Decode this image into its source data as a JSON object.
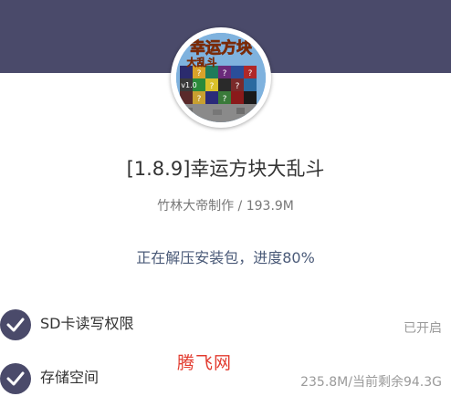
{
  "header": {
    "color": "#4a4a6a"
  },
  "app": {
    "icon": "minecraft-lucky-block-icon",
    "title": "[1.8.9]幸运方块大乱斗",
    "subtitle": "竹林大帝制作 / 193.9M"
  },
  "progress": {
    "text": "正在解压安装包，进度80%",
    "percent": 80
  },
  "permissions": [
    {
      "label": "SD卡读写权限",
      "status": "已开启",
      "icon": "check-circle-icon"
    },
    {
      "label": "存储空间",
      "status": "235.8M/当前剩余94.3G",
      "icon": "check-circle-icon"
    }
  ],
  "watermark": {
    "text": "腾飞网",
    "color": "#e23a2e"
  },
  "avatar_text": {
    "line1": "幸运方块",
    "line2": "大乱斗",
    "version": "v1.0"
  }
}
